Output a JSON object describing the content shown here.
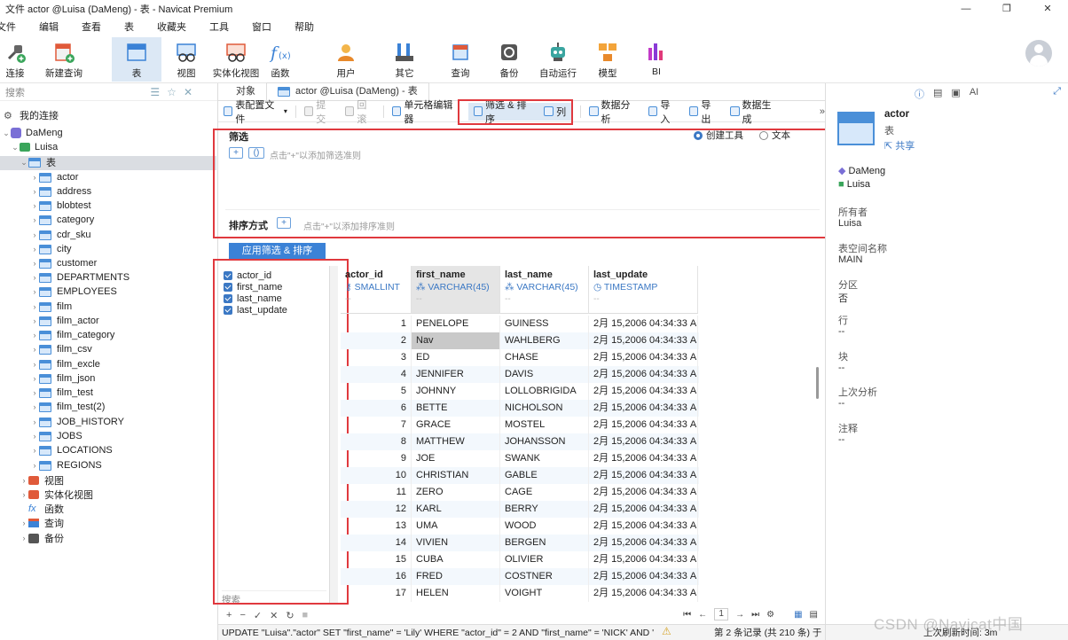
{
  "window": {
    "title": "文件 actor @Luisa (DaMeng) - 表 - Navicat Premium",
    "controls": [
      "—",
      "❐",
      "✕"
    ]
  },
  "menu": [
    "文件",
    "编辑",
    "查看",
    "表",
    "收藏夹",
    "工具",
    "窗口",
    "帮助"
  ],
  "toolbar": [
    {
      "label": "连接",
      "icon": "plug-icon"
    },
    {
      "label": "新建查询",
      "icon": "new-query-icon"
    },
    {
      "label": "表",
      "icon": "table-icon"
    },
    {
      "label": "视图",
      "icon": "view-icon"
    },
    {
      "label": "实体化视图",
      "icon": "materialized-view-icon"
    },
    {
      "label": "函数",
      "icon": "function-icon"
    },
    {
      "label": "用户",
      "icon": "user-icon"
    },
    {
      "label": "其它",
      "icon": "other-icon"
    },
    {
      "label": "查询",
      "icon": "query-icon"
    },
    {
      "label": "备份",
      "icon": "backup-icon"
    },
    {
      "label": "自动运行",
      "icon": "robot-icon"
    },
    {
      "label": "模型",
      "icon": "model-icon"
    },
    {
      "label": "BI",
      "icon": "bi-icon"
    }
  ],
  "sidebar": {
    "search_placeholder": "搜索",
    "my_connections": "我的连接",
    "connection": "DaMeng",
    "schema": "Luisa",
    "tables_folder": "表",
    "tables": [
      "actor",
      "address",
      "blobtest",
      "category",
      "cdr_sku",
      "city",
      "customer",
      "DEPARTMENTS",
      "EMPLOYEES",
      "film",
      "film_actor",
      "film_category",
      "film_csv",
      "film_excle",
      "film_json",
      "film_test",
      "film_test(2)",
      "JOB_HISTORY",
      "JOBS",
      "LOCATIONS",
      "REGIONS"
    ],
    "other_nodes": [
      "视图",
      "实体化视图",
      "函数",
      "查询",
      "备份"
    ]
  },
  "tabs": {
    "objects": "对象",
    "active": "actor @Luisa (DaMeng) - 表"
  },
  "subtoolbar": {
    "table_config": "表配置文件",
    "commit": "提交",
    "rollback": "回滚",
    "cell_editor": "单元格编辑器",
    "filter_sort": "筛选 & 排序",
    "columns": "列",
    "data_analysis": "数据分析",
    "import": "导入",
    "export": "导出",
    "data_gen": "数据生成"
  },
  "filter": {
    "title": "筛选",
    "hint": "点击\"+\"以添加筛选准则",
    "radio_builder": "创建工具",
    "radio_text": "文本",
    "sort_title": "排序方式",
    "sort_hint": "点击\"+\"以添加排序准则",
    "apply": "应用筛选 & 排序"
  },
  "column_pane": {
    "items": [
      "actor_id",
      "first_name",
      "last_name",
      "last_update"
    ],
    "search_placeholder": "搜索"
  },
  "grid": {
    "columns": [
      {
        "name": "actor_id",
        "type": "SMALLINT",
        "default": "--"
      },
      {
        "name": "first_name",
        "type": "VARCHAR(45)",
        "default": "--"
      },
      {
        "name": "last_name",
        "type": "VARCHAR(45)",
        "default": "--"
      },
      {
        "name": "last_update",
        "type": "TIMESTAMP",
        "default": "--"
      }
    ],
    "rows": [
      [
        "1",
        "PENELOPE",
        "GUINESS",
        "2月 15,2006 04:34:33 AM"
      ],
      [
        "2",
        "Nav",
        "WAHLBERG",
        "2月 15,2006 04:34:33 AM"
      ],
      [
        "3",
        "ED",
        "CHASE",
        "2月 15,2006 04:34:33 AM"
      ],
      [
        "4",
        "JENNIFER",
        "DAVIS",
        "2月 15,2006 04:34:33 AM"
      ],
      [
        "5",
        "JOHNNY",
        "LOLLOBRIGIDA",
        "2月 15,2006 04:34:33 AM"
      ],
      [
        "6",
        "BETTE",
        "NICHOLSON",
        "2月 15,2006 04:34:33 AM"
      ],
      [
        "7",
        "GRACE",
        "MOSTEL",
        "2月 15,2006 04:34:33 AM"
      ],
      [
        "8",
        "MATTHEW",
        "JOHANSSON",
        "2月 15,2006 04:34:33 AM"
      ],
      [
        "9",
        "JOE",
        "SWANK",
        "2月 15,2006 04:34:33 AM"
      ],
      [
        "10",
        "CHRISTIAN",
        "GABLE",
        "2月 15,2006 04:34:33 AM"
      ],
      [
        "11",
        "ZERO",
        "CAGE",
        "2月 15,2006 04:34:33 AM"
      ],
      [
        "12",
        "KARL",
        "BERRY",
        "2月 15,2006 04:34:33 AM"
      ],
      [
        "13",
        "UMA",
        "WOOD",
        "2月 15,2006 04:34:33 AM"
      ],
      [
        "14",
        "VIVIEN",
        "BERGEN",
        "2月 15,2006 04:34:33 AM"
      ],
      [
        "15",
        "CUBA",
        "OLIVIER",
        "2月 15,2006 04:34:33 AM"
      ],
      [
        "16",
        "FRED",
        "COSTNER",
        "2月 15,2006 04:34:33 AM"
      ],
      [
        "17",
        "HELEN",
        "VOIGHT",
        "2月 15,2006 04:34:33 AM"
      ]
    ]
  },
  "pager": {
    "page": "1"
  },
  "statusbar": {
    "sql": "UPDATE \"Luisa\".\"actor\" SET \"first_name\" = 'Lily' WHERE \"actor_id\" = 2 AND \"first_name\" = 'NICK' AND '",
    "record_info": "第 2 条记录 (共 210 条) 于第 1 页",
    "refresh": "上次刷新时间: 3m"
  },
  "info_panel": {
    "name": "actor",
    "kind": "表",
    "share": "共享",
    "connection": "DaMeng",
    "schema": "Luisa",
    "owner_label": "所有者",
    "owner": "Luisa",
    "tablespace_label": "表空间名称",
    "tablespace": "MAIN",
    "partition_label": "分区",
    "partition": "否",
    "rows_label": "行",
    "rows": "--",
    "blocks_label": "块",
    "blocks": "--",
    "last_analyzed_label": "上次分析",
    "last_analyzed": "--",
    "comment_label": "注释",
    "comment": "--"
  },
  "watermark": "CSDN @Navicat中国",
  "colors": {
    "accent": "#3b78c4",
    "highlight": "#e0393e"
  }
}
